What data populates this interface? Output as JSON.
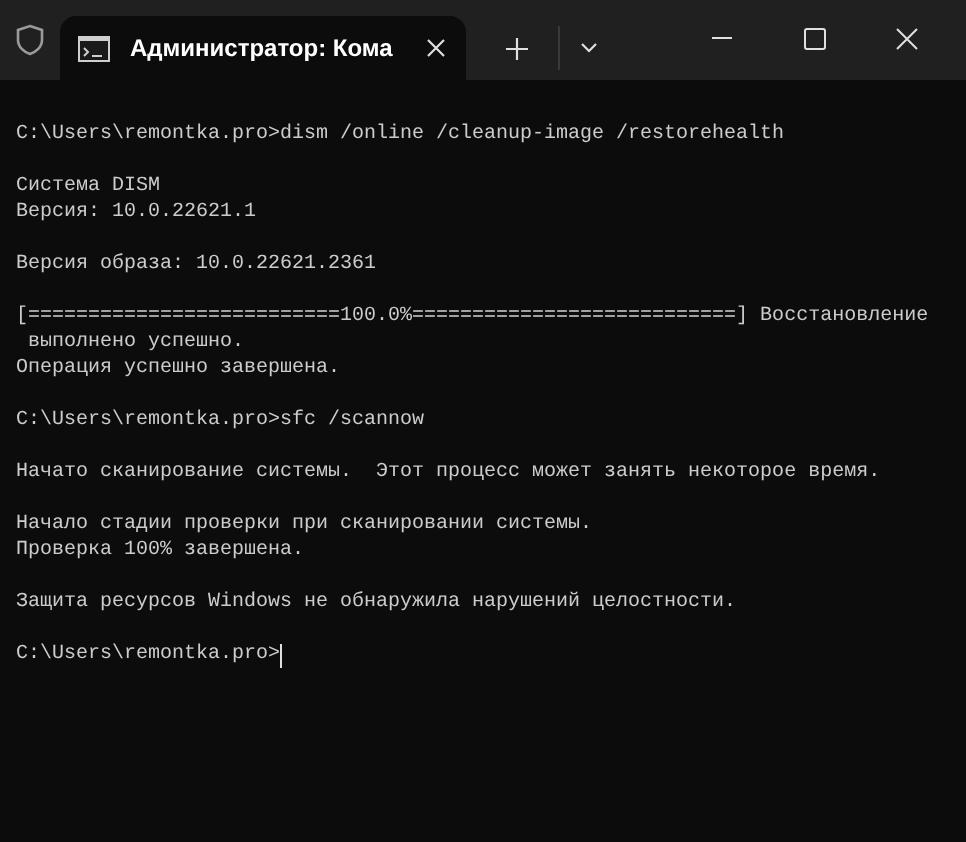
{
  "tab": {
    "title": "Администратор: Кома",
    "selected": true
  },
  "blocks": [
    [
      "C:\\Users\\remontka.pro>dism /online /cleanup-image /restorehealth"
    ],
    [
      "Система DISM",
      "Версия: 10.0.22621.1"
    ],
    [
      "Версия образа: 10.0.22621.2361"
    ],
    [
      "[==========================100.0%===========================] Восстановление",
      " выполнено успешно.",
      "Операция успешно завершена."
    ],
    [
      "C:\\Users\\remontka.pro>sfc /scannow"
    ],
    [
      "Начато сканирование системы.  Этот процесс может занять некоторое время."
    ],
    [
      "Начало стадии проверки при сканировании системы.",
      "Проверка 100% завершена."
    ],
    [
      "Защита ресурсов Windows не обнаружила нарушений целостности."
    ],
    [
      "C:\\Users\\remontka.pro>"
    ]
  ],
  "cursor": true
}
